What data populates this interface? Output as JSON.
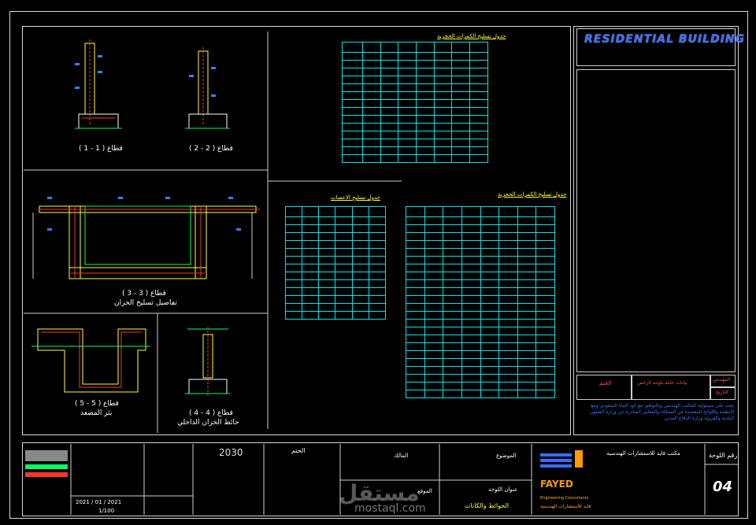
{
  "sections": {
    "s1": "قطاع ( 1 - 1 )",
    "s2": "قطاع ( 2 - 2 )",
    "s3a": "قطاع ( 3 - 3 )",
    "s3b": "تفاصيل تسليح الخزان",
    "s5a": "قطاع ( 5 - 5 )",
    "s5b": "بئر المصعد",
    "s4a": "قطاع ( 4 - 4 )",
    "s4b": "حائط الخزان الداخلي"
  },
  "schedules": {
    "top_title": "جدول تسليح الكمرات الحجرية",
    "left_title": "جدول تسليح الاعصاب",
    "right_title": "جدول تسليح الكمرات الحجرية"
  },
  "title_block": {
    "project_title": "RESIDENTIAL BUILDING",
    "notes": "يجب على مسئولية المكتب الهندسي وبالتوافق مع كود البناء السعودي ومع الانظمة واللوائح المعتمدة في المملكة والمعايير الصادرة عن وزارة الشئون البلدية والقروية وزارة الدفاع المدني",
    "stamp_label": "الختم",
    "engineer_label": "المهندس",
    "date_label": "التاريخ",
    "project_label": "بيانات عامة بلوحة الرخص",
    "sheet_no_label": "رقم اللوحة",
    "sheet_no": "04",
    "scale": "1/100",
    "date": "2021 / 01 / 2021",
    "office_name": "مكتب فايد للاستشارات الهندسية",
    "brand_en": "FAYED",
    "brand_sub": "Engineering Consultants",
    "brand_ar": "فايد للاستشارات الهندسية",
    "vision": "2030",
    "owner_label": "المالك",
    "location_label": "الموقع",
    "subject_label": "الموضوع",
    "drawing_label": "عنوان اللوحة",
    "drawing_title": "الحوائط والكانات",
    "watermark": "mostaql.com",
    "watermark_ar": "مستقل"
  }
}
